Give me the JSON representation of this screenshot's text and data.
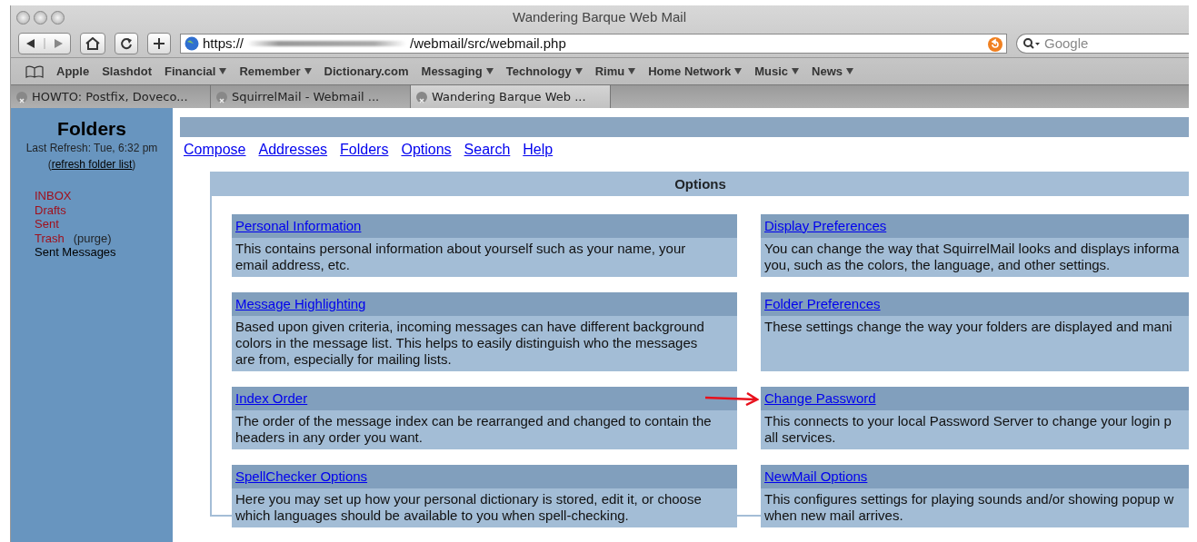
{
  "window": {
    "title": "Wandering Barque Web Mail"
  },
  "toolbar": {
    "url_prefix": "https://",
    "url_path": "/webmail/src/webmail.php",
    "search_placeholder": "Google"
  },
  "bookmarks": [
    {
      "label": "Apple",
      "menu": false
    },
    {
      "label": "Slashdot",
      "menu": false
    },
    {
      "label": "Financial",
      "menu": true
    },
    {
      "label": "Remember",
      "menu": true
    },
    {
      "label": "Dictionary.com",
      "menu": false
    },
    {
      "label": "Messaging",
      "menu": true
    },
    {
      "label": "Technology",
      "menu": true
    },
    {
      "label": "Rimu",
      "menu": true
    },
    {
      "label": "Home Network",
      "menu": true
    },
    {
      "label": "Music",
      "menu": true
    },
    {
      "label": "News",
      "menu": true
    }
  ],
  "tabs": [
    {
      "label": "HOWTO: Postfix, Doveco...",
      "selected": false
    },
    {
      "label": "SquirrelMail - Webmail ...",
      "selected": false
    },
    {
      "label": "Wandering Barque Web ...",
      "selected": true
    }
  ],
  "sidebar": {
    "title": "Folders",
    "refresh_text": "Last Refresh: Tue, 6:32 pm",
    "refresh_open": "(",
    "refresh_link": "refresh folder list",
    "refresh_close": ")",
    "folders": [
      {
        "name": "INBOX",
        "color": "#a0101c"
      },
      {
        "name": "Drafts",
        "color": "#a0101c"
      },
      {
        "name": "Sent",
        "color": "#a0101c"
      },
      {
        "name": "Trash",
        "color": "#a0101c",
        "extra": "(purge)"
      },
      {
        "name": "Sent Messages",
        "color": "#000000"
      }
    ]
  },
  "nav_links": [
    "Compose",
    "Addresses",
    "Folders",
    "Options",
    "Search",
    "Help"
  ],
  "options": {
    "title": "Options",
    "columns": [
      [
        {
          "title": "Personal Information",
          "description": "This contains personal information about yourself such as your name, your\nemail address, etc."
        },
        {
          "title": "Message Highlighting",
          "description": "Based upon given criteria, incoming messages can have different background\ncolors in the message list. This helps to easily distinguish who the messages\nare from, especially for mailing lists."
        },
        {
          "title": "Index Order",
          "description": "The order of the message index can be rearranged and changed to contain the\nheaders in any order you want."
        },
        {
          "title": "SpellChecker Options",
          "description": "Here you may set up how your personal dictionary is stored, edit it, or choose\nwhich languages should be available to you when spell-checking."
        }
      ],
      [
        {
          "title": "Display Preferences",
          "description": "You can change the way that SquirrelMail looks and displays informa\nyou, such as the colors, the language, and other settings."
        },
        {
          "title": "Folder Preferences",
          "description": "These settings change the way your folders are displayed and mani"
        },
        {
          "title": "Change Password",
          "description": "This connects to your local Password Server to change your login p\nall services.",
          "annotated": true
        },
        {
          "title": "NewMail Options",
          "description": "This configures settings for playing sounds and/or showing popup w\nwhen new mail arrives."
        }
      ]
    ]
  }
}
